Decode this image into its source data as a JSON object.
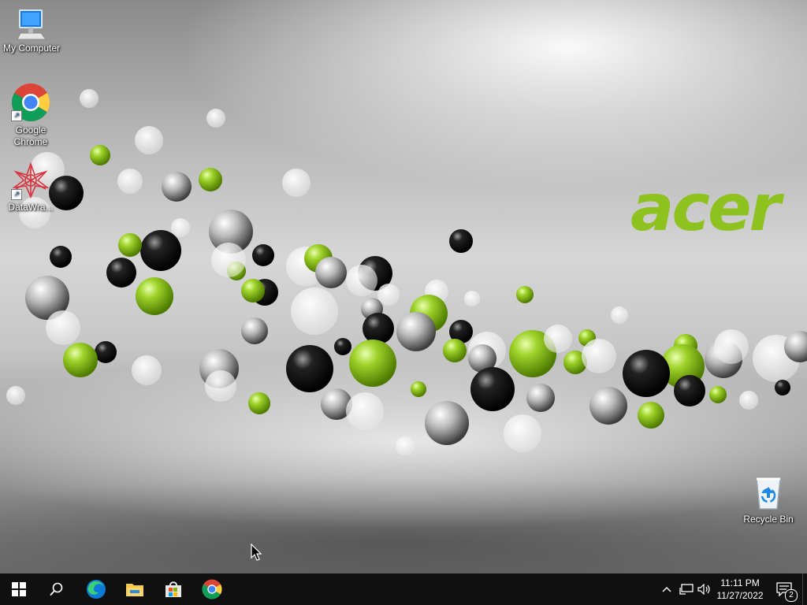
{
  "desktop": {
    "brand_logo": "acer",
    "icons": [
      {
        "label": "My Computer",
        "icon": "computer-icon"
      },
      {
        "label": "Google Chrome",
        "icon": "chrome-icon"
      },
      {
        "label": "DataWra...",
        "icon": "datawrapper-icon"
      },
      {
        "label": "Recycle Bin",
        "icon": "recycle-bin-icon"
      }
    ]
  },
  "taskbar": {
    "start": "windows-start-icon",
    "search": "search-icon",
    "pinned": [
      "edge-icon",
      "file-explorer-icon",
      "store-icon",
      "chrome-icon"
    ],
    "tray": {
      "chevron": "chevron-up-icon",
      "network": "network-icon",
      "volume": "volume-icon",
      "time": "11:11 PM",
      "date": "11/27/2022",
      "notification_count": "2"
    }
  },
  "colors": {
    "accent_green": "#8dc21f",
    "taskbar": "#101010"
  }
}
